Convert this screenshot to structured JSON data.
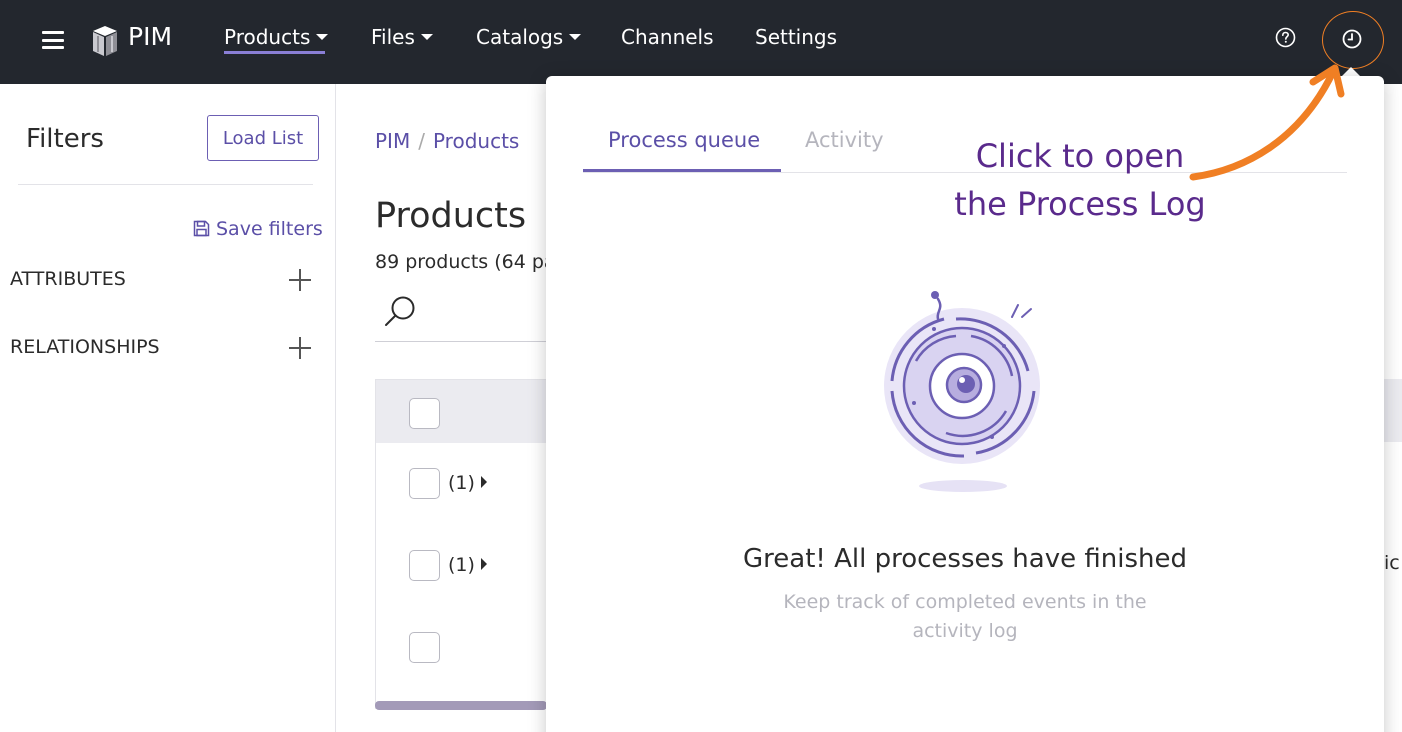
{
  "app": {
    "logo_text": "PIM"
  },
  "nav": {
    "items": [
      {
        "label": "Products",
        "dropdown": true,
        "active": true
      },
      {
        "label": "Files",
        "dropdown": true
      },
      {
        "label": "Catalogs",
        "dropdown": true
      },
      {
        "label": "Channels",
        "dropdown": false
      },
      {
        "label": "Settings",
        "dropdown": false
      }
    ],
    "icons": [
      "menu-icon",
      "help-icon",
      "process-clock-icon"
    ]
  },
  "sidebar": {
    "title": "Filters",
    "load_list_label": "Load List",
    "save_filters_label": "Save filters",
    "sections": [
      {
        "label": "ATTRIBUTES"
      },
      {
        "label": "RELATIONSHIPS"
      }
    ]
  },
  "main": {
    "breadcrumb": [
      "PIM",
      "Products"
    ],
    "title": "Products",
    "count_text": "89 products (64 pa",
    "rows": [
      {
        "count": "(1)"
      },
      {
        "count": "(1)"
      },
      {
        "count": ""
      }
    ],
    "cut_text": "ic"
  },
  "popover": {
    "tabs": [
      {
        "label": "Process queue",
        "active": true
      },
      {
        "label": "Activity",
        "active": false
      }
    ],
    "empty_title": "Great! All processes have finished",
    "empty_subtitle": "Keep track of completed events in the activity log"
  },
  "annotation": {
    "line1": "Click to open",
    "line2": "the Process Log",
    "color": "#5a2a8c",
    "arrow_color": "#f07f24"
  },
  "colors": {
    "topbar": "#23272e",
    "accent": "#6c5fb3",
    "highlight": "#f07f24"
  }
}
